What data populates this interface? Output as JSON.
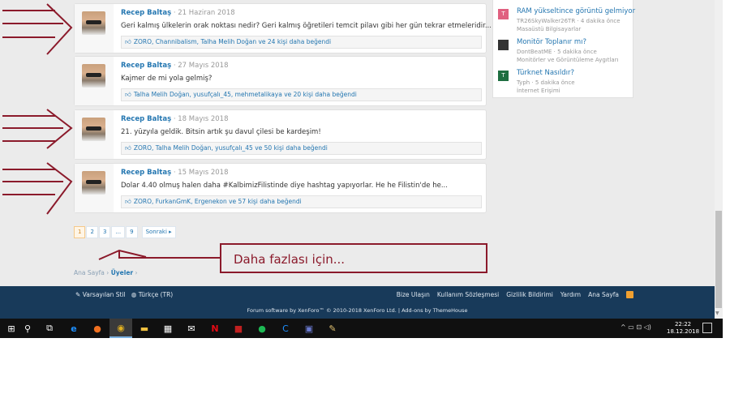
{
  "posts": [
    {
      "author": "Recep Baltaş",
      "date": "21 Haziran 2018",
      "text": "Geri kalmış ülkelerin orak noktası nedir? Geri kalmış öğretileri temcit pilavı gibi her gün tekrar etmeleridir...",
      "likes": "ZORO, Channibalism, Talha Melih Doğan ve 24 kişi daha beğendi"
    },
    {
      "author": "Recep Baltaş",
      "date": "27 Mayıs 2018",
      "text": "Kajmer de mi yola gelmiş?",
      "likes": "Talha Melih Doğan, yusufçalı_45, mehmetalikaya ve 20 kişi daha beğendi"
    },
    {
      "author": "Recep Baltaş",
      "date": "18 Mayıs 2018",
      "text": "21. yüzyıla geldik. Bitsin artık şu davul çilesi be kardeşim!",
      "likes": "ZORO, Talha Melih Doğan, yusufçalı_45 ve 50 kişi daha beğendi"
    },
    {
      "author": "Recep Baltaş",
      "date": "15 Mayıs 2018",
      "text": "Dolar 4.40 olmuş halen daha #KalbimizFilistinde diye hashtag yapıyorlar. He he Filistin'de he...",
      "likes": "ZORO, FurkanGmK, Ergenekon ve 57 kişi daha beğendi"
    }
  ],
  "sidebar": {
    "threads": [
      {
        "icon": "T",
        "color": "#e06080",
        "title": "RAM yükseltince görüntü gelmiyor",
        "meta": "TR26SkyWalker26TR · 4 dakika önce",
        "forum": "Masaüstü Bilgisayarlar"
      },
      {
        "icon": "",
        "color": "#333333",
        "title": "Monitör Toplanır mı?",
        "meta": "DontBeatME · 5 dakika önce",
        "forum": "Monitörler ve Görüntüleme Aygıtları"
      },
      {
        "icon": "T",
        "color": "#1e6e40",
        "title": "Türknet Nasıldır?",
        "meta": "Typh · 5 dakika önce",
        "forum": "İnternet Erişimi"
      }
    ]
  },
  "pager": {
    "pages": [
      "1",
      "2",
      "3",
      "...",
      "9"
    ],
    "next": "Sonraki ▸"
  },
  "annotation": "Daha fazlası için...",
  "breadcrumb": {
    "home": "Ana Sayfa",
    "current": "Üyeler"
  },
  "footer": {
    "style": "Varsayılan Stil",
    "language": "Türkçe (TR)",
    "links": [
      "Bize Ulaşın",
      "Kullanım Sözleşmesi",
      "Gizlilik Bildirimi",
      "Yardım",
      "Ana Sayfa"
    ],
    "copyright": "Forum software by XenForo™ © 2010-2018 XenForo Ltd. | Add-ons by ThemeHouse"
  },
  "taskbar": {
    "time": "22:22",
    "date": "18.12.2018"
  },
  "colors": {
    "accent": "#2577b1",
    "annotation": "#8b1a2b",
    "footer": "#183a5a"
  }
}
